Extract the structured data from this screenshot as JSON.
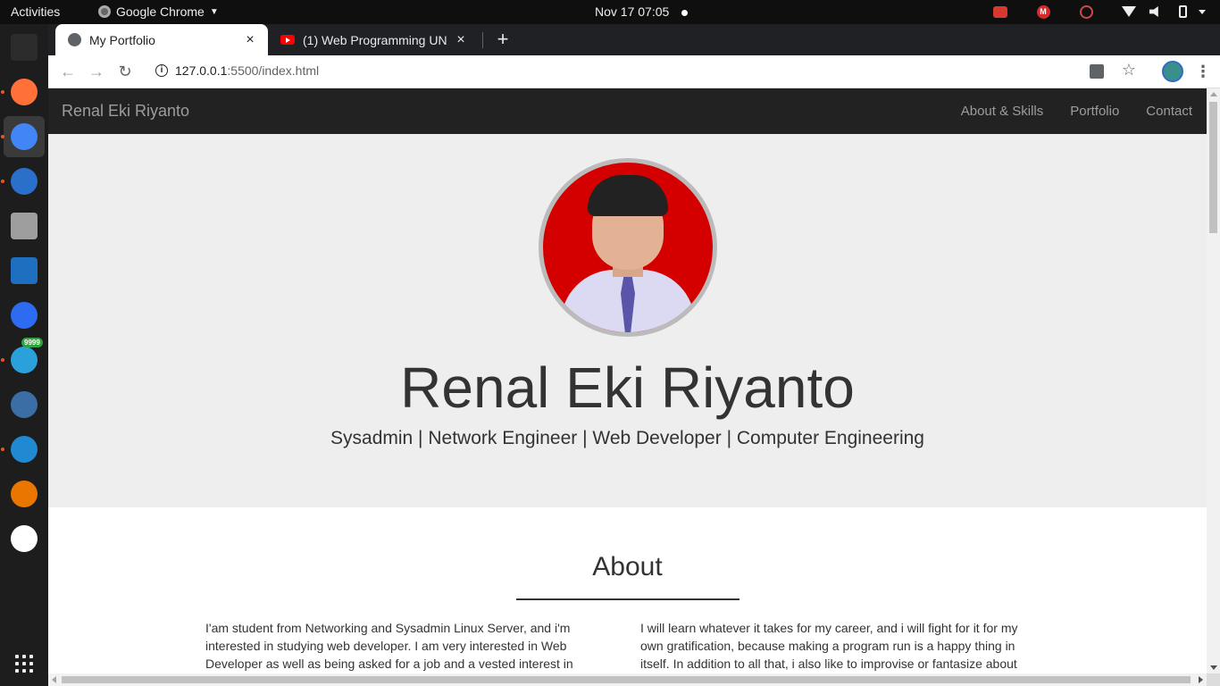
{
  "topbar": {
    "activities": "Activities",
    "app_name": "Google Chrome",
    "clock": "Nov 17  07:05",
    "tray_badge": "M"
  },
  "dock": {
    "apps": [
      {
        "name": "terminal",
        "color": "#2c2c2c"
      },
      {
        "name": "firefox",
        "color": "#ff7139"
      },
      {
        "name": "chrome",
        "color": "#4285f4"
      },
      {
        "name": "thunderbird",
        "color": "#2a6fc9"
      },
      {
        "name": "files",
        "color": "#9e9e9e"
      },
      {
        "name": "libreoffice-writer",
        "color": "#1e6fbf"
      },
      {
        "name": "wps-office",
        "color": "#2d6cf0"
      },
      {
        "name": "telegram",
        "color": "#2aa1da"
      },
      {
        "name": "virtualbox",
        "color": "#3a6ea5"
      },
      {
        "name": "vscode",
        "color": "#1f8ad2"
      },
      {
        "name": "blender",
        "color": "#ea7600"
      },
      {
        "name": "inkscape",
        "color": "#ffffff"
      }
    ],
    "telegram_badge": "9999"
  },
  "browser": {
    "tabs": [
      {
        "title": "My Portfolio",
        "close": "×"
      },
      {
        "title": "(1) Web Programming UN",
        "close": "×"
      }
    ],
    "new_tab": "+",
    "url_host": "127.0.0.1",
    "url_path": ":5500/index.html"
  },
  "page": {
    "brand": "Renal Eki Riyanto",
    "nav": [
      "About & Skills",
      "Portfolio",
      "Contact"
    ],
    "hero_name": "Renal Eki Riyanto",
    "hero_tagline": "Sysadmin | Network Engineer | Web Developer | Computer Engineering",
    "about_title": "About",
    "about_left": "I'am student from Networking and Sysadmin Linux Server, and i'm interested in studying web developer. I am very interested in Web Developer as well as being asked for a job and a vested interest in",
    "about_right": "I will learn whatever it takes for my career, and i will fight for it for my own gratification, because making a program run is a happy thing in itself. In addition to all that, i also like to improvise or fantasize about creating new"
  },
  "colors": {
    "navbar_bg": "#222222",
    "hero_bg": "#eeeeee",
    "avatar_bg": "#d40000"
  }
}
